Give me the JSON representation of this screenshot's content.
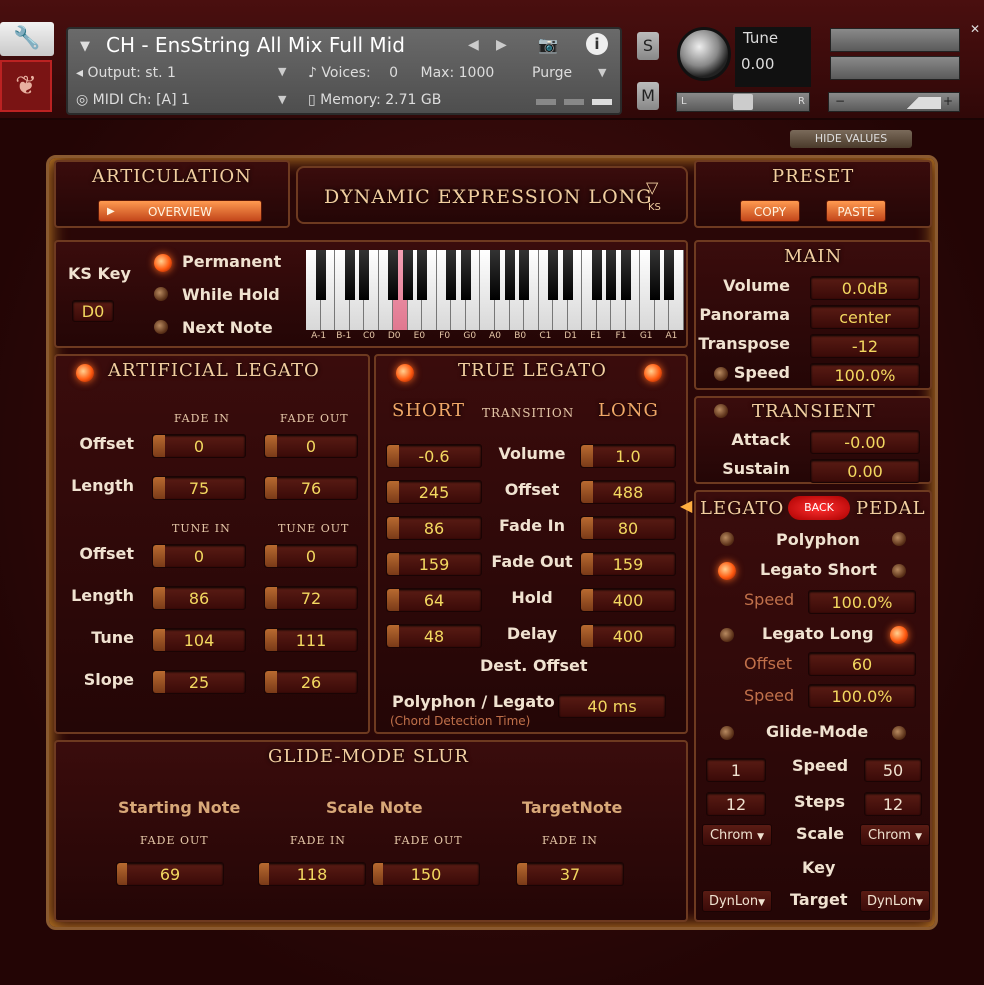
{
  "header": {
    "instrument_name": "CH - EnsString All Mix Full Mid",
    "output_label": "Output:",
    "output_value": "st. 1",
    "voices_label": "Voices:",
    "voices_value": "0",
    "max_label": "Max:",
    "max_value": "1000",
    "purge_label": "Purge",
    "midi_label": "MIDI Ch:",
    "midi_value": "[A]  1",
    "memory_label": "Memory:",
    "memory_value": "2.71 GB",
    "s_label": "S",
    "m_label": "M",
    "tune_label": "Tune",
    "tune_value": "0.00",
    "pan_l": "L",
    "pan_r": "R"
  },
  "hide_values": "HIDE VALUES",
  "articulation": {
    "title": "ARTICULATION",
    "overview": "OVERVIEW",
    "current": "DYNAMIC EXPRESSION LONG",
    "ks": "KS"
  },
  "preset": {
    "title": "PRESET",
    "copy": "COPY",
    "paste": "PASTE"
  },
  "keyswitch": {
    "ks_key_label": "KS Key",
    "ks_key_value": "D0",
    "modes": [
      "Permanent",
      "While Hold",
      "Next Note"
    ],
    "active_mode": 0,
    "key_labels": [
      "A-1",
      "B-1",
      "C0",
      "D0",
      "E0",
      "F0",
      "G0",
      "A0",
      "B0",
      "C1",
      "D1",
      "E1",
      "F1",
      "G1",
      "A1"
    ],
    "highlighted_key": 3
  },
  "main": {
    "title": "MAIN",
    "rows": [
      {
        "label": "Volume",
        "value": "0.0dB"
      },
      {
        "label": "Panorama",
        "value": "center"
      },
      {
        "label": "Transpose",
        "value": "-12"
      },
      {
        "label": "Speed",
        "value": "100.0%"
      }
    ]
  },
  "transient": {
    "title": "TRANSIENT",
    "rows": [
      {
        "label": "Attack",
        "value": "-0.00"
      },
      {
        "label": "Sustain",
        "value": "0.00"
      }
    ]
  },
  "artificial_legato": {
    "title": "ARTIFICIAL LEGATO",
    "fade_in": "FADE IN",
    "fade_out": "FADE OUT",
    "tune_in": "TUNE IN",
    "tune_out": "TUNE OUT",
    "offset_label": "Offset",
    "length_label": "Length",
    "tune_label": "Tune",
    "slope_label": "Slope",
    "fade_offset": [
      "0",
      "0"
    ],
    "fade_length": [
      "75",
      "76"
    ],
    "tune_offset": [
      "0",
      "0"
    ],
    "tune_length": [
      "86",
      "72"
    ],
    "tune_tune": [
      "104",
      "111"
    ],
    "tune_slope": [
      "25",
      "26"
    ]
  },
  "true_legato": {
    "title": "TRUE LEGATO",
    "short": "SHORT",
    "transition": "TRANSITION",
    "long": "LONG",
    "rows": [
      {
        "label": "Volume",
        "short": "-0.6",
        "long": "1.0"
      },
      {
        "label": "Offset",
        "short": "245",
        "long": "488"
      },
      {
        "label": "Fade In",
        "short": "86",
        "long": "80"
      },
      {
        "label": "Fade Out",
        "short": "159",
        "long": "159"
      },
      {
        "label": "Hold",
        "short": "64",
        "long": "400"
      },
      {
        "label": "Delay",
        "short": "48",
        "long": "400"
      }
    ],
    "dest_offset": "Dest. Offset",
    "polyphon_label": "Polyphon / Legato",
    "polyphon_sub": "(Chord Detection Time)",
    "polyphon_value": "40 ms"
  },
  "legato_pedal": {
    "legato": "LEGATO",
    "back": "BACK",
    "pedal": "PEDAL",
    "polyphon": "Polyphon",
    "legato_short": "Legato Short",
    "speed_label": "Speed",
    "legato_short_speed": "100.0%",
    "legato_long": "Legato Long",
    "offset_label": "Offset",
    "legato_long_offset": "60",
    "legato_long_speed": "100.0%",
    "glide_mode": "Glide-Mode",
    "glide_speed_left": "1",
    "glide_speed_right": "50",
    "steps_label": "Steps",
    "steps_left": "12",
    "steps_right": "12",
    "scale_label": "Scale",
    "scale_left": "Chrom",
    "scale_right": "Chrom",
    "key_label": "Key",
    "target_label": "Target",
    "target_left": "DynLon",
    "target_right": "DynLon"
  },
  "glide_slur": {
    "title": "GLIDE-MODE SLUR",
    "starting_note": "Starting Note",
    "scale_note": "Scale Note",
    "target_note": "TargetNote",
    "fade_out": "FADE OUT",
    "fade_in": "FADE IN",
    "start_fade_out": "69",
    "scale_fade_in": "118",
    "scale_fade_out": "150",
    "target_fade_in": "37"
  }
}
